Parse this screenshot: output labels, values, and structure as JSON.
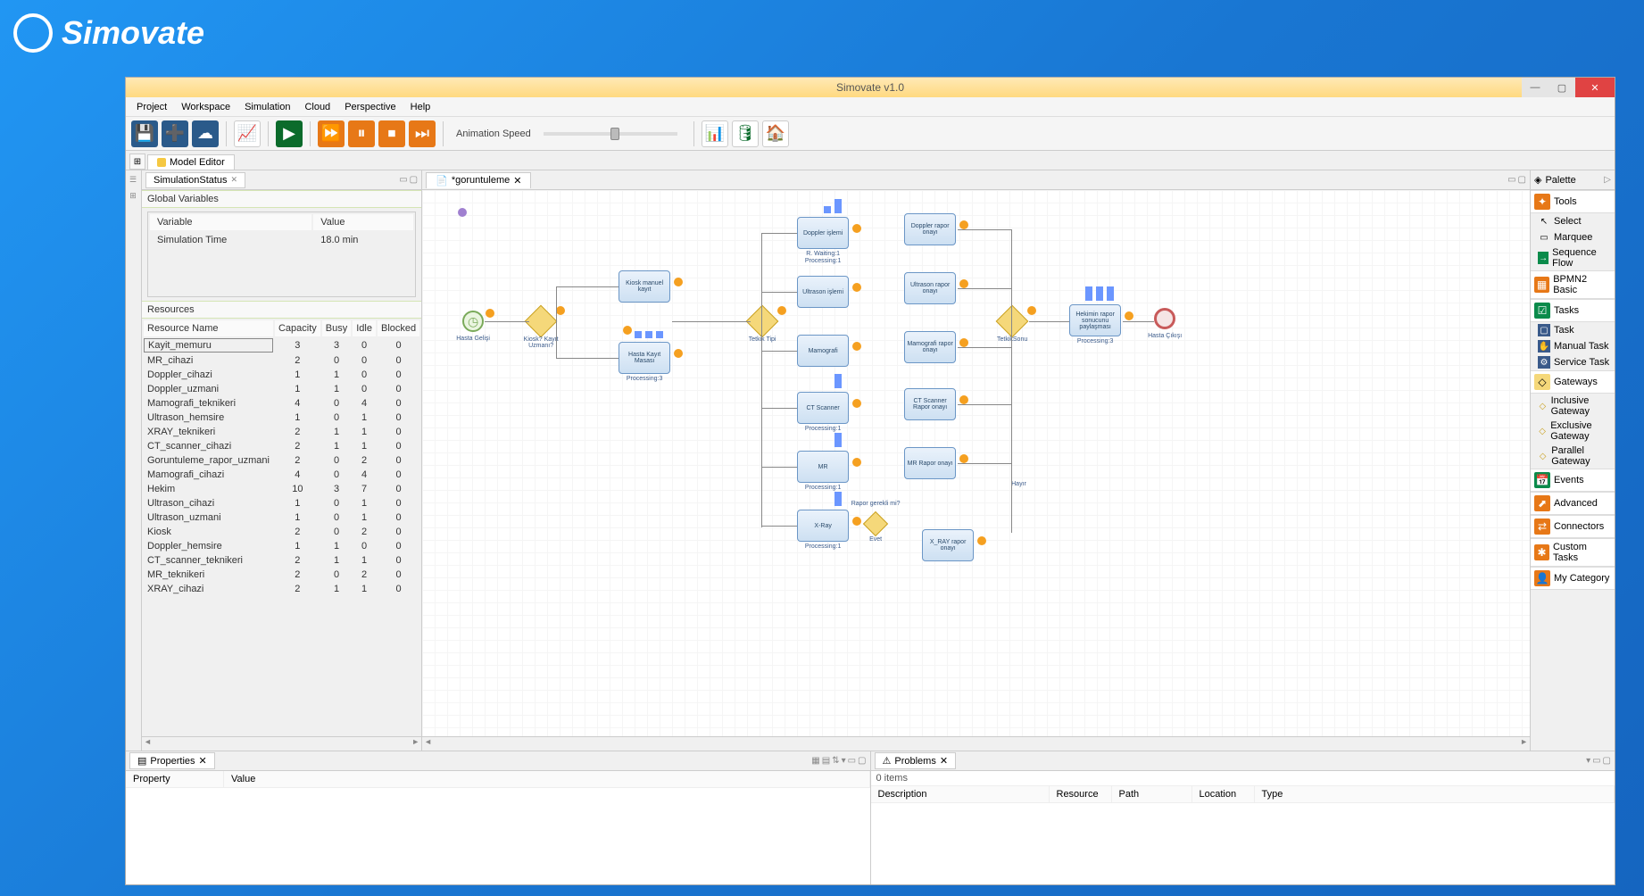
{
  "app": {
    "title": "Simovate v1.0",
    "logo": "Simovate"
  },
  "menu": [
    "Project",
    "Workspace",
    "Simulation",
    "Cloud",
    "Perspective",
    "Help"
  ],
  "toolbar": {
    "animation_speed": "Animation Speed"
  },
  "editor_tab": "Model Editor",
  "simstatus": {
    "title": "SimulationStatus",
    "global_vars_header": "Global Variables",
    "var_col": "Variable",
    "val_col": "Value",
    "vars": [
      {
        "name": "Simulation Time",
        "value": "18.0 min"
      }
    ],
    "resources_header": "Resources",
    "res_cols": [
      "Resource Name",
      "Capacity",
      "Busy",
      "Idle",
      "Blocked"
    ],
    "resources": [
      {
        "name": "Kayit_memuru",
        "cap": "3",
        "busy": "3",
        "idle": "0",
        "blk": "0",
        "hl": true
      },
      {
        "name": "MR_cihazi",
        "cap": "2",
        "busy": "0",
        "idle": "0",
        "blk": "0"
      },
      {
        "name": "Doppler_cihazi",
        "cap": "1",
        "busy": "1",
        "idle": "0",
        "blk": "0"
      },
      {
        "name": "Doppler_uzmani",
        "cap": "1",
        "busy": "1",
        "idle": "0",
        "blk": "0"
      },
      {
        "name": "Mamografi_teknikeri",
        "cap": "4",
        "busy": "0",
        "idle": "4",
        "blk": "0"
      },
      {
        "name": "Ultrason_hemsire",
        "cap": "1",
        "busy": "0",
        "idle": "1",
        "blk": "0"
      },
      {
        "name": "XRAY_teknikeri",
        "cap": "2",
        "busy": "1",
        "idle": "1",
        "blk": "0"
      },
      {
        "name": "CT_scanner_cihazi",
        "cap": "2",
        "busy": "1",
        "idle": "1",
        "blk": "0"
      },
      {
        "name": "Goruntuleme_rapor_uzmani",
        "cap": "2",
        "busy": "0",
        "idle": "2",
        "blk": "0"
      },
      {
        "name": "Mamografi_cihazi",
        "cap": "4",
        "busy": "0",
        "idle": "4",
        "blk": "0"
      },
      {
        "name": "Hekim",
        "cap": "10",
        "busy": "3",
        "idle": "7",
        "blk": "0"
      },
      {
        "name": "Ultrason_cihazi",
        "cap": "1",
        "busy": "0",
        "idle": "1",
        "blk": "0"
      },
      {
        "name": "Ultrason_uzmani",
        "cap": "1",
        "busy": "0",
        "idle": "1",
        "blk": "0"
      },
      {
        "name": "Kiosk",
        "cap": "2",
        "busy": "0",
        "idle": "2",
        "blk": "0"
      },
      {
        "name": "Doppler_hemsire",
        "cap": "1",
        "busy": "1",
        "idle": "0",
        "blk": "0"
      },
      {
        "name": "CT_scanner_teknikeri",
        "cap": "2",
        "busy": "1",
        "idle": "1",
        "blk": "0"
      },
      {
        "name": "MR_teknikeri",
        "cap": "2",
        "busy": "0",
        "idle": "2",
        "blk": "0"
      },
      {
        "name": "XRAY_cihazi",
        "cap": "2",
        "busy": "1",
        "idle": "1",
        "blk": "0"
      }
    ]
  },
  "canvas": {
    "tab": "*goruntuleme",
    "start": "Hasta Gelişi",
    "gw1": "Kiosk? Kayıt Uzmanı?",
    "task_manual": "Kiosk manuel kayıt",
    "task_kayit": "Hasta Kayıt Masası",
    "task_kayit_sub": "Processing:3",
    "gw2": "Tetkik Tipi",
    "gw3": "TetkikSonu",
    "tasks": {
      "doppler": "Doppler işlemi",
      "doppler_sub": "R. Waiting:1\nProcessing:1",
      "doppler_r": "Doppler rapor onayı",
      "ultrason": "Ultrason işlemi",
      "ultrason_r": "Ultrason rapor onayı",
      "mamo": "Mamografi",
      "mamo_r": "Mamografi rapor onayı",
      "ct": "CT Scanner",
      "ct_sub": "Processing:1",
      "ct_r": "CT Scanner Rapor onayı",
      "mr": "MR",
      "mr_sub": "Processing:1",
      "mr_r": "MR Rapor onayı",
      "xray": "X-Ray",
      "xray_sub": "Processing:1",
      "xray_gw": "Rapor gerekli mi?",
      "xray_gw2": "Evet",
      "xray_r": "X_RAY rapor onayı"
    },
    "hekim": "Hekimin rapor sonucunu paylaşması",
    "hekim_sub": "Processing:3",
    "end": "Hasta Çıkışı",
    "hayir": "Hayır"
  },
  "palette": {
    "title": "Palette",
    "cats": {
      "tools": "Tools",
      "bpmn": "BPMN2 Basic",
      "tasks": "Tasks",
      "gateways": "Gateways",
      "events": "Events",
      "advanced": "Advanced",
      "connectors": "Connectors",
      "custom": "Custom Tasks",
      "mycat": "My Category"
    },
    "items": {
      "select": "Select",
      "marquee": "Marquee",
      "seqflow": "Sequence Flow",
      "task": "Task",
      "manualtask": "Manual Task",
      "servicetask": "Service Task",
      "incgw": "Inclusive Gateway",
      "excgw": "Exclusive Gateway",
      "pargw": "Parallel Gateway"
    }
  },
  "properties": {
    "title": "Properties",
    "cols": [
      "Property",
      "Value"
    ]
  },
  "problems": {
    "title": "Problems",
    "count": "0 items",
    "cols": [
      "Description",
      "Resource",
      "Path",
      "Location",
      "Type"
    ]
  }
}
